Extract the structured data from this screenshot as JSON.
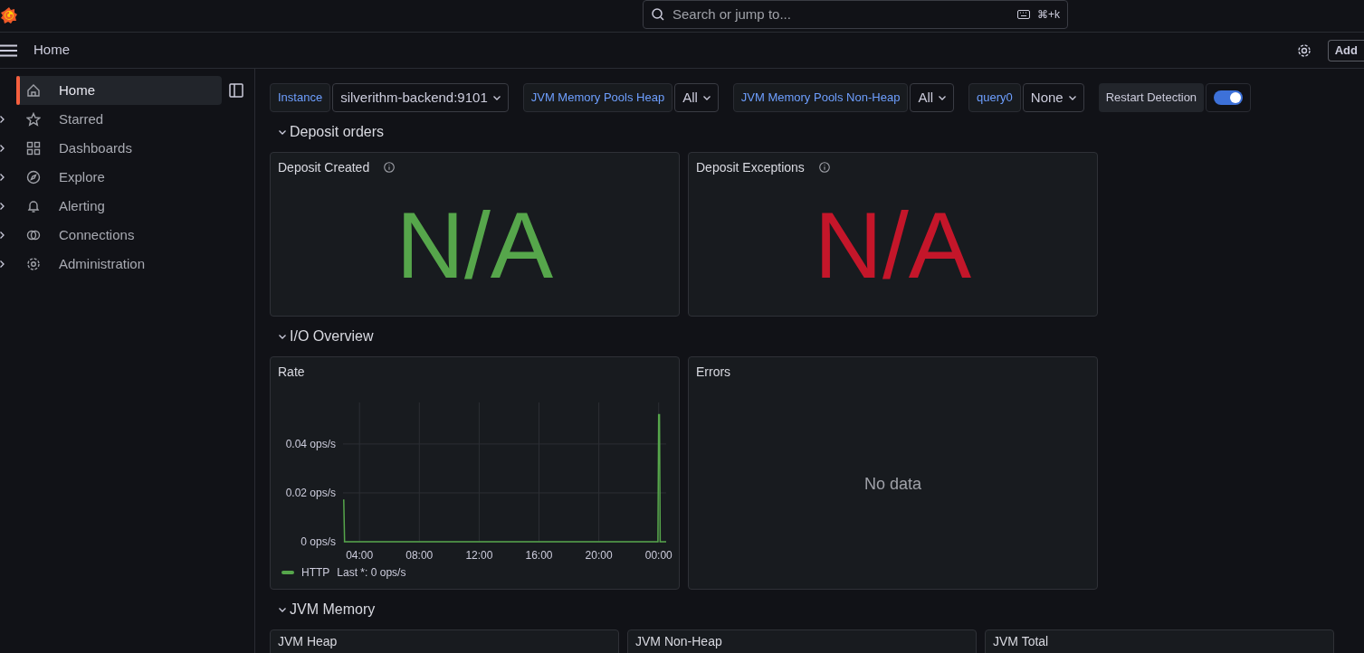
{
  "topbar": {
    "search_placeholder": "Search or jump to...",
    "shortcut": "⌘+k",
    "add_button": "Add"
  },
  "breadcrumb": "Home",
  "sidebar": {
    "items": [
      {
        "label": "Home",
        "selected": true,
        "expandable": false
      },
      {
        "label": "Starred",
        "selected": false,
        "expandable": true
      },
      {
        "label": "Dashboards",
        "selected": false,
        "expandable": true
      },
      {
        "label": "Explore",
        "selected": false,
        "expandable": true
      },
      {
        "label": "Alerting",
        "selected": false,
        "expandable": true
      },
      {
        "label": "Connections",
        "selected": false,
        "expandable": true
      },
      {
        "label": "Administration",
        "selected": false,
        "expandable": true
      }
    ]
  },
  "variables": [
    {
      "kind": "select",
      "label": "Instance",
      "value": "silverithm-backend:9101"
    },
    {
      "kind": "select",
      "label": "JVM Memory Pools Heap",
      "value": "All"
    },
    {
      "kind": "select",
      "label": "JVM Memory Pools Non-Heap",
      "value": "All"
    },
    {
      "kind": "select",
      "label": "query0",
      "value": "None"
    },
    {
      "kind": "switch",
      "label": "Restart Detection",
      "on": true
    }
  ],
  "rows": [
    {
      "title": "Deposit orders",
      "expanded": true,
      "panels": [
        {
          "kind": "stat",
          "title": "Deposit Created",
          "info": true,
          "value": "N/A",
          "color": "#56a64b"
        },
        {
          "kind": "stat",
          "title": "Deposit Exceptions",
          "info": true,
          "value": "N/A",
          "color": "#c4162a"
        }
      ]
    },
    {
      "title": "I/O Overview",
      "expanded": true,
      "panels": [
        {
          "kind": "timeseries",
          "title": "Rate",
          "legend_values": [
            "Last *: 0 ops/s"
          ],
          "chart_data": {
            "type": "line",
            "x": [
              2.9,
              2.95,
              3.0,
              3.05,
              23.95,
              24.0,
              24.05,
              24.1,
              24.5
            ],
            "series": [
              {
                "name": "HTTP",
                "color": "#56a64b",
                "values": [
                  0.017,
                  0.017,
                  0,
                  0,
                  0,
                  0.052,
                  0.052,
                  0,
                  0
                ]
              }
            ],
            "grid": true,
            "xlim": [
              2.9,
              24.5
            ],
            "ylim": [
              0,
              0.057
            ],
            "xticks": [
              {
                "value": 4,
                "label": "04:00"
              },
              {
                "value": 8,
                "label": "08:00"
              },
              {
                "value": 12,
                "label": "12:00"
              },
              {
                "value": 16,
                "label": "16:00"
              },
              {
                "value": 20,
                "label": "20:00"
              },
              {
                "value": 24,
                "label": "00:00"
              }
            ],
            "yticks": [
              {
                "value": 0,
                "label": "0 ops/s"
              },
              {
                "value": 0.02,
                "label": "0.02 ops/s"
              },
              {
                "value": 0.04,
                "label": "0.04 ops/s"
              }
            ]
          }
        },
        {
          "kind": "nodata",
          "title": "Errors",
          "message": "No data"
        }
      ]
    },
    {
      "title": "JVM Memory",
      "expanded": true,
      "panels": [
        {
          "kind": "empty",
          "title": "JVM Heap"
        },
        {
          "kind": "empty",
          "title": "JVM Non-Heap"
        },
        {
          "kind": "empty",
          "title": "JVM Total"
        }
      ]
    }
  ]
}
